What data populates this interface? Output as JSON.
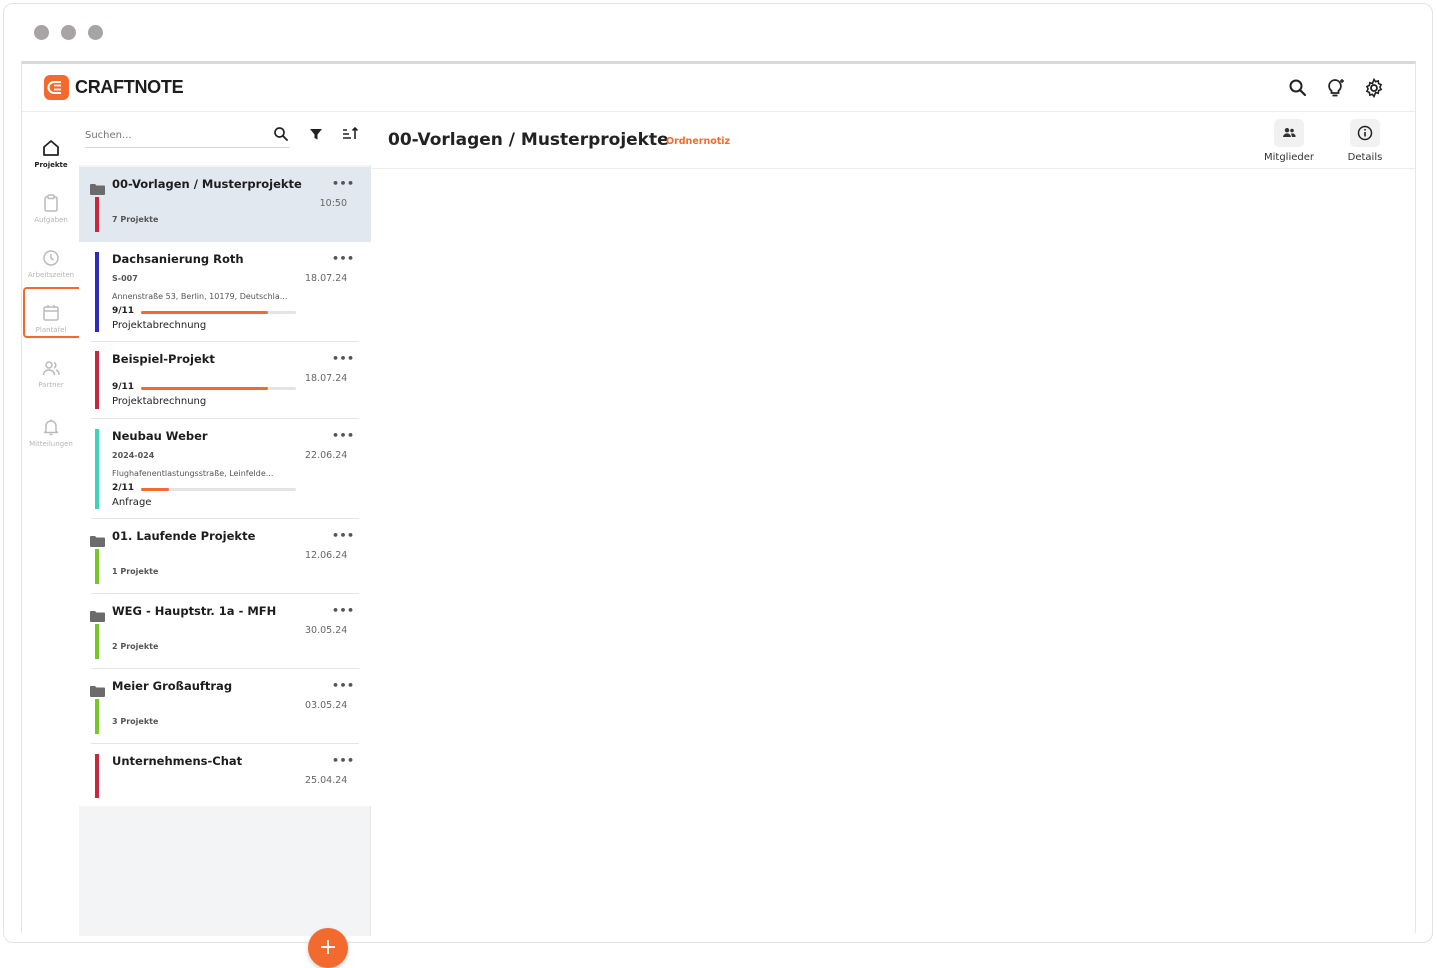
{
  "app": {
    "brand": "CRAFTNOTE"
  },
  "header_icons": [
    "search-icon",
    "lightbulb-icon",
    "gear-icon"
  ],
  "nav": [
    {
      "label": "Projekte",
      "icon": "home-icon",
      "active": true
    },
    {
      "label": "Aufgaben",
      "icon": "clipboard-icon"
    },
    {
      "label": "Arbeitszeiten",
      "icon": "clock-icon"
    },
    {
      "label": "Plantafel",
      "icon": "calendar-icon"
    },
    {
      "label": "Partner",
      "icon": "users-icon"
    },
    {
      "label": "Mitteilungen",
      "icon": "bell-icon"
    }
  ],
  "search": {
    "placeholder": "Suchen..."
  },
  "items": [
    {
      "type": "folder",
      "title": "00-Vorlagen / Musterprojekte",
      "date": "10:50",
      "sub": "7 Projekte",
      "color": "#c8283c",
      "selected": true
    },
    {
      "type": "project",
      "title": "Dachsanierung Roth",
      "date": "18.07.24",
      "sub": "S-007",
      "address": "Annenstraße 53, Berlin, 10179, Deutschla...",
      "progress_label": "9/11",
      "progress": 0.82,
      "phase": "Projektabrechnung",
      "color": "#2e2ac0"
    },
    {
      "type": "project",
      "title": "Beispiel-Projekt",
      "date": "18.07.24",
      "progress_label": "9/11",
      "progress": 0.82,
      "phase": "Projektabrechnung",
      "color": "#c8283c"
    },
    {
      "type": "project",
      "title": "Neubau Weber",
      "date": "22.06.24",
      "sub": "2024-024",
      "address": "Flughafenentlastungsstraße, Leinfelde...",
      "progress_label": "2/11",
      "progress": 0.18,
      "phase": "Anfrage",
      "color": "#3fd3b8"
    },
    {
      "type": "folder",
      "title": "01. Laufende Projekte",
      "date": "12.06.24",
      "sub": "1 Projekte",
      "color": "#77c72b"
    },
    {
      "type": "folder",
      "title": "WEG - Hauptstr. 1a - MFH",
      "date": "30.05.24",
      "sub": "2 Projekte",
      "color": "#77c72b"
    },
    {
      "type": "folder",
      "title": "Meier Großauftrag",
      "date": "03.05.24",
      "sub": "3 Projekte",
      "color": "#77c72b"
    },
    {
      "type": "project",
      "title": "Unternehmens-Chat",
      "date": "25.04.24",
      "color": "#c8283c"
    }
  ],
  "main": {
    "title": "00-Vorlagen / Musterprojekte",
    "note_link": "Ordnernotiz",
    "members_label": "Mitglieder",
    "details_label": "Details"
  },
  "fab": {
    "label": "+"
  }
}
